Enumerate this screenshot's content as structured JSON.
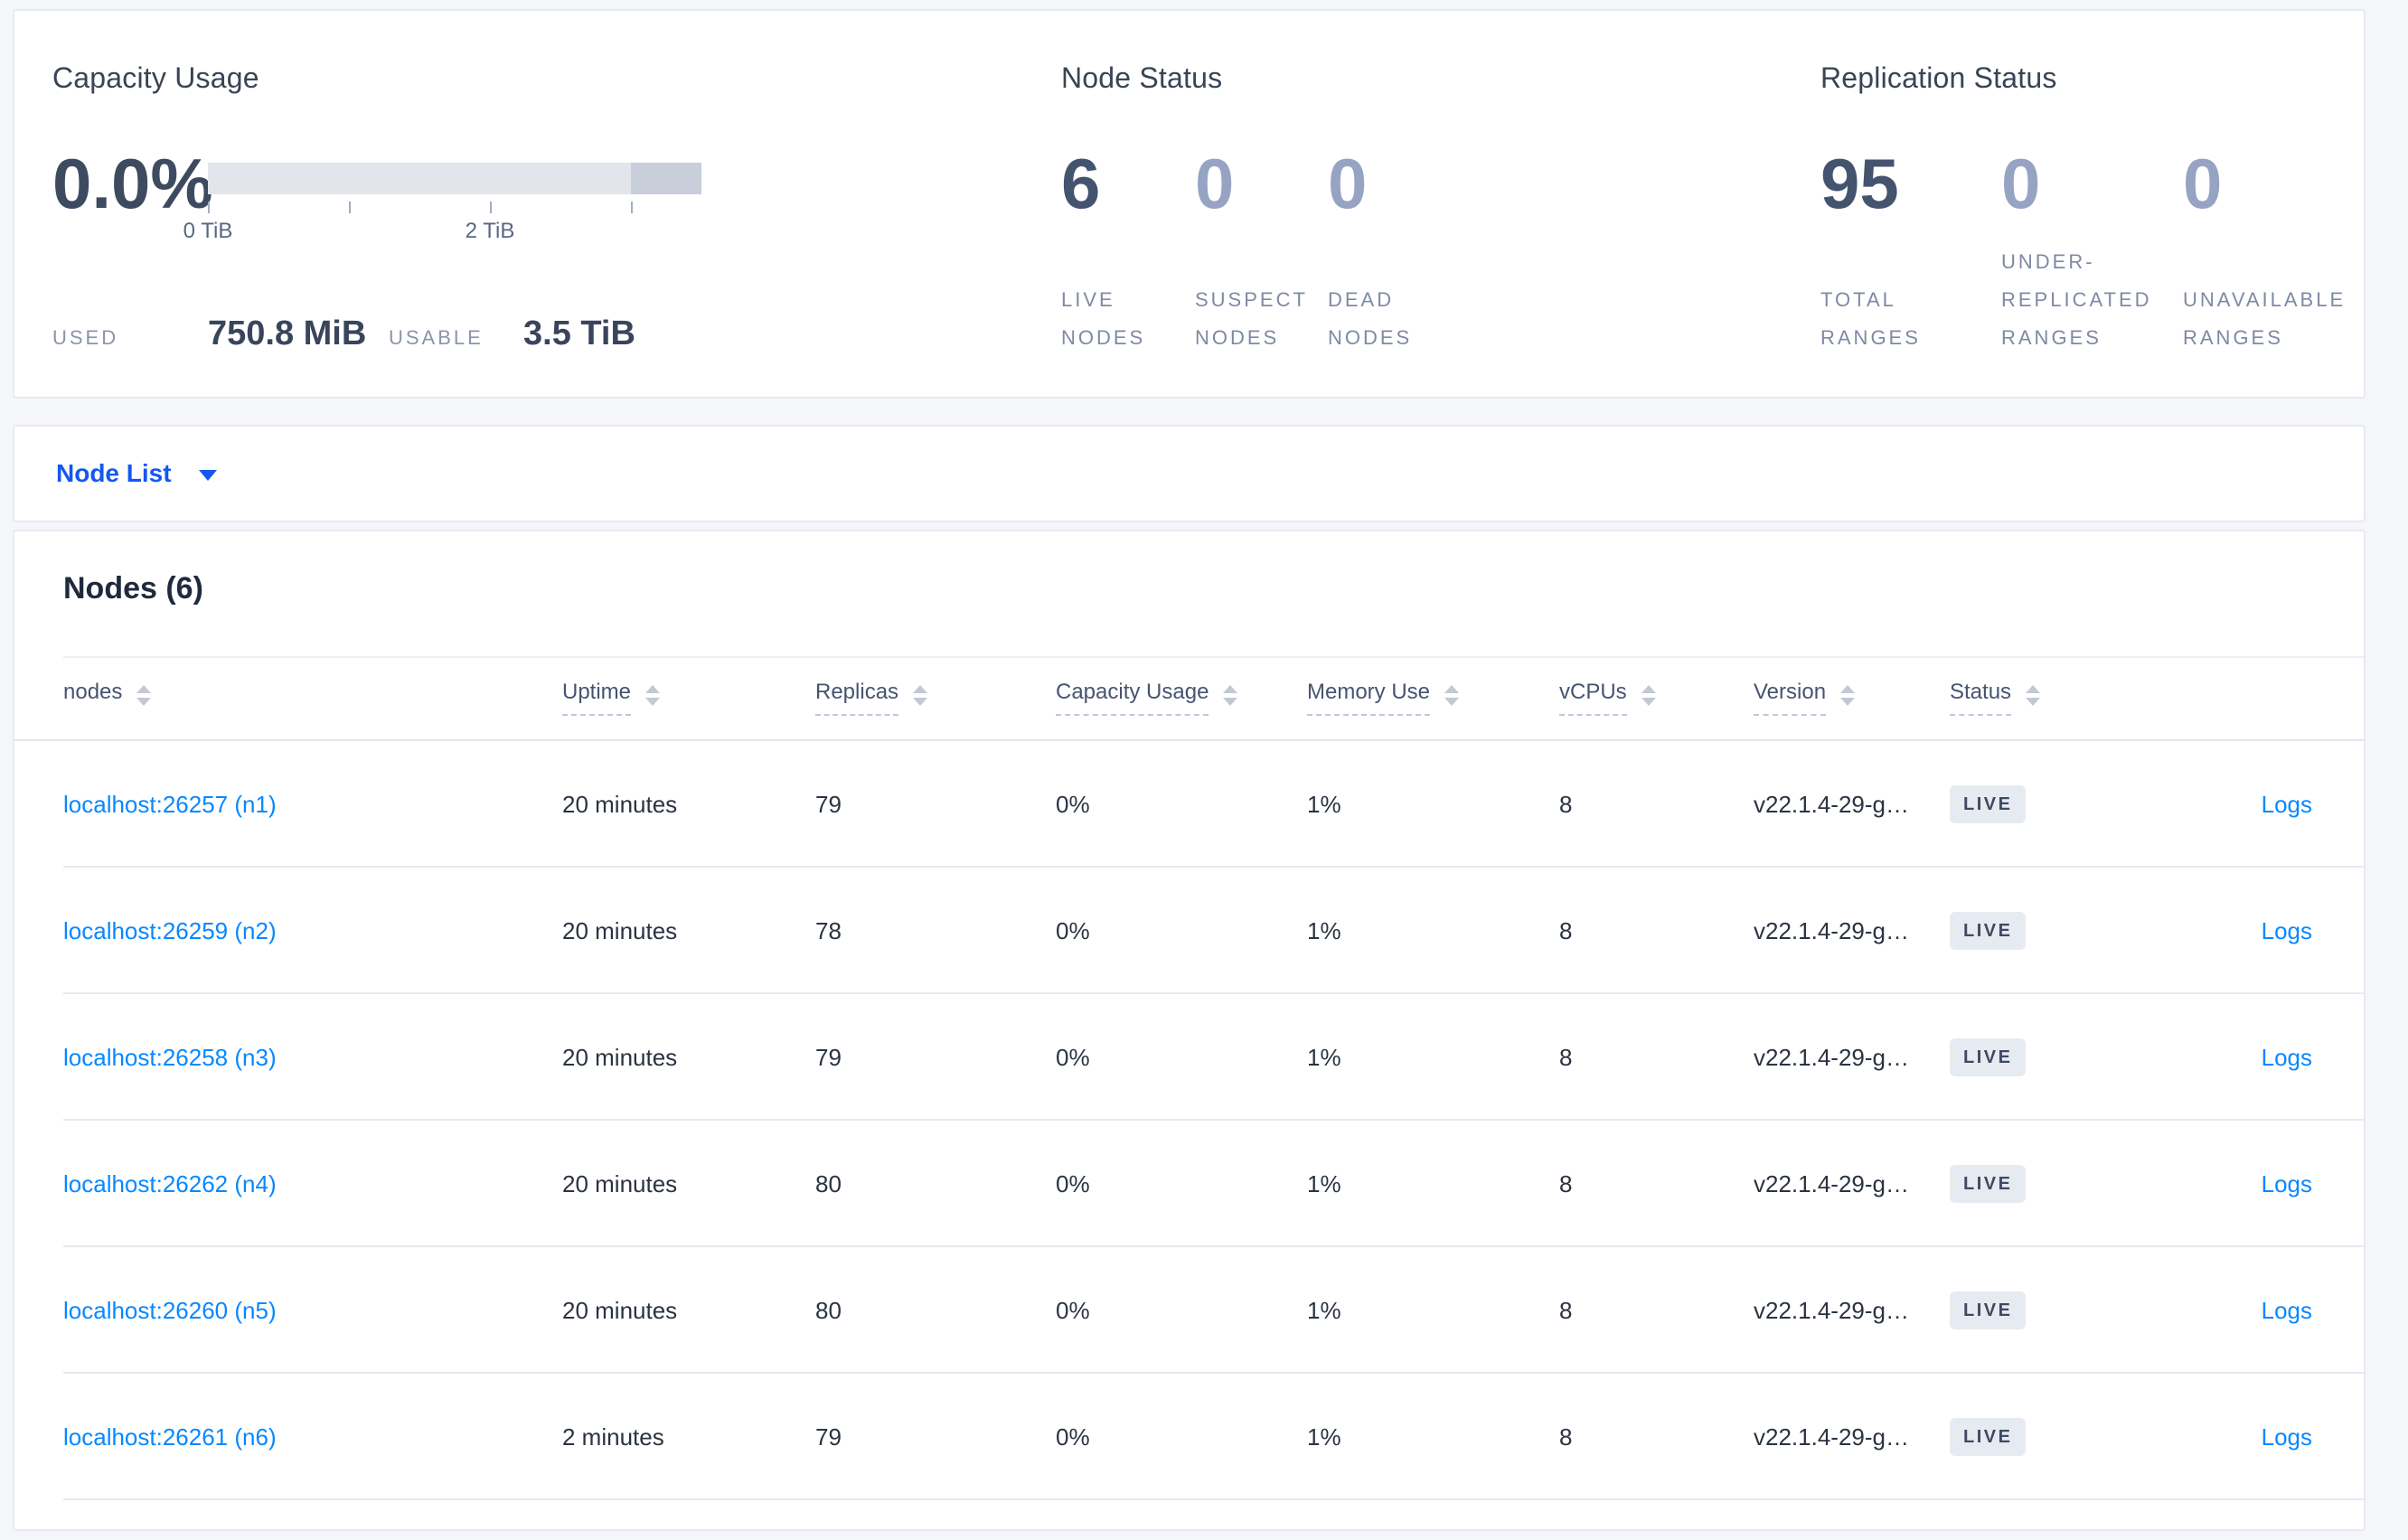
{
  "capacity": {
    "title": "Capacity Usage",
    "percent": "0.0%",
    "tick_labels": [
      "0 TiB",
      "2 TiB"
    ],
    "used_label": "USED",
    "used_value": "750.8 MiB",
    "usable_label": "USABLE",
    "usable_value": "3.5 TiB"
  },
  "node_status": {
    "title": "Node Status",
    "stats": [
      {
        "value": "6",
        "label": "LIVE NODES"
      },
      {
        "value": "0",
        "label": "SUSPECT NODES"
      },
      {
        "value": "0",
        "label": "DEAD NODES"
      }
    ]
  },
  "replication_status": {
    "title": "Replication Status",
    "stats": [
      {
        "value": "95",
        "label": "TOTAL RANGES"
      },
      {
        "value": "0",
        "label": "UNDER-REPLICATED RANGES"
      },
      {
        "value": "0",
        "label": "UNAVAILABLE RANGES"
      }
    ]
  },
  "node_list": {
    "label": "Node List"
  },
  "nodes_table": {
    "title": "Nodes (6)",
    "logs_label": "Logs",
    "columns": [
      {
        "label": "nodes"
      },
      {
        "label": "Uptime"
      },
      {
        "label": "Replicas"
      },
      {
        "label": "Capacity Usage"
      },
      {
        "label": "Memory Use"
      },
      {
        "label": "vCPUs"
      },
      {
        "label": "Version"
      },
      {
        "label": "Status"
      }
    ],
    "rows": [
      {
        "name": "localhost:26257 (n1)",
        "uptime": "20 minutes",
        "replicas": "79",
        "capacity": "0%",
        "memory": "1%",
        "vcpus": "8",
        "version": "v22.1.4-29-g…",
        "status": "LIVE"
      },
      {
        "name": "localhost:26259 (n2)",
        "uptime": "20 minutes",
        "replicas": "78",
        "capacity": "0%",
        "memory": "1%",
        "vcpus": "8",
        "version": "v22.1.4-29-g…",
        "status": "LIVE"
      },
      {
        "name": "localhost:26258 (n3)",
        "uptime": "20 minutes",
        "replicas": "79",
        "capacity": "0%",
        "memory": "1%",
        "vcpus": "8",
        "version": "v22.1.4-29-g…",
        "status": "LIVE"
      },
      {
        "name": "localhost:26262 (n4)",
        "uptime": "20 minutes",
        "replicas": "80",
        "capacity": "0%",
        "memory": "1%",
        "vcpus": "8",
        "version": "v22.1.4-29-g…",
        "status": "LIVE"
      },
      {
        "name": "localhost:26260 (n5)",
        "uptime": "20 minutes",
        "replicas": "80",
        "capacity": "0%",
        "memory": "1%",
        "vcpus": "8",
        "version": "v22.1.4-29-g…",
        "status": "LIVE"
      },
      {
        "name": "localhost:26261 (n6)",
        "uptime": "2 minutes",
        "replicas": "79",
        "capacity": "0%",
        "memory": "1%",
        "vcpus": "8",
        "version": "v22.1.4-29-g…",
        "status": "LIVE"
      }
    ]
  },
  "colors": {
    "table_link_blue": "#0788ff",
    "dropdown_blue": "#1457f1",
    "badge_bg": "#e6ebf1",
    "stat_number_dark": "#44536e",
    "stat_number_dim": "#96a3c2",
    "capacity_bar_fill": "#e2e5ec",
    "capacity_bar_tail": "#c9cedb",
    "page_bg": "#f4f6fa"
  }
}
